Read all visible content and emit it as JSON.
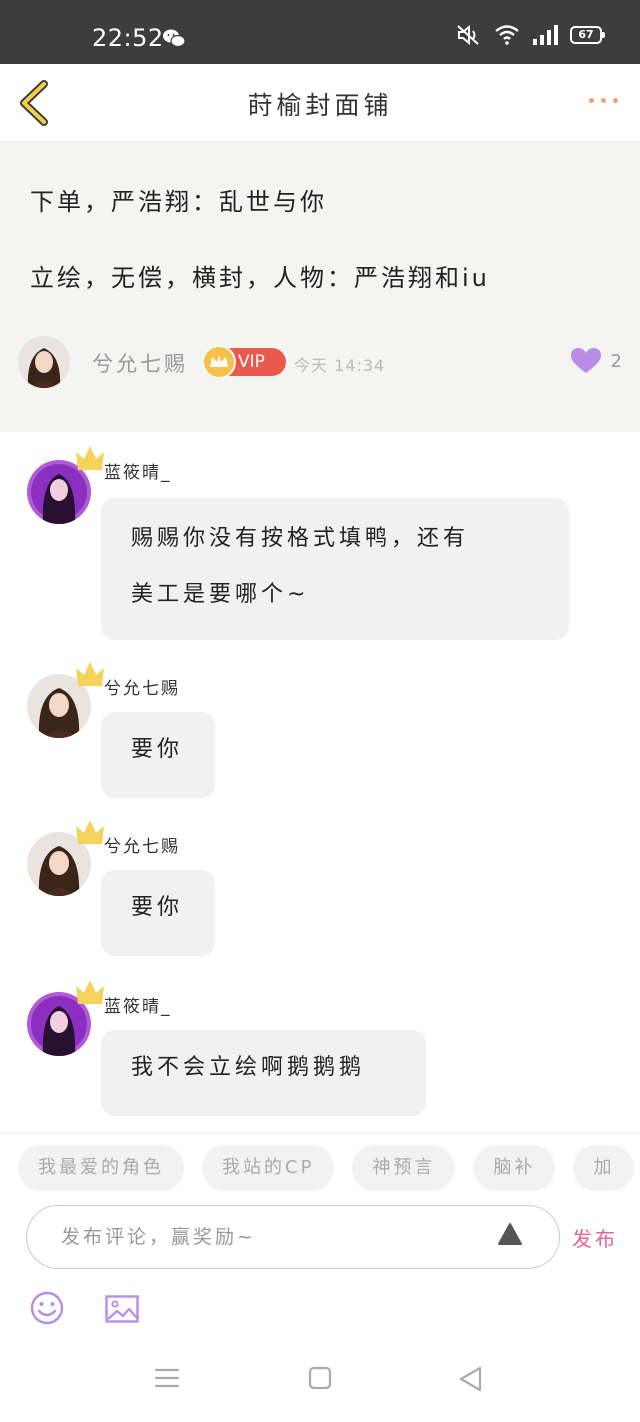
{
  "status_bar": {
    "time": "22:52",
    "battery": "67"
  },
  "header": {
    "title": "莳榆封面铺"
  },
  "post": {
    "line1": "下单，严浩翔：乱世与你",
    "line2": "立绘，无偿，横封，人物：严浩翔和iu",
    "author": "兮允七赐",
    "vip_label": "VIP",
    "time": "今天 14:34",
    "likes": "2"
  },
  "comments": [
    {
      "name": "蓝筱晴_",
      "lines": [
        "赐赐你没有按格式填鸭，还有",
        "美工是要哪个~"
      ]
    },
    {
      "name": "兮允七赐",
      "lines": [
        "要你"
      ]
    },
    {
      "name": "兮允七赐",
      "lines": [
        "要你"
      ]
    },
    {
      "name": "蓝筱晴_",
      "lines": [
        "我不会立绘啊鹅鹅鹅"
      ]
    }
  ],
  "tags": [
    "我最爱的角色",
    "我站的CP",
    "神预言",
    "脑补",
    "加"
  ],
  "comment_box": {
    "placeholder": "发布评论，赢奖励~",
    "publish_label": "发布"
  },
  "colors": {
    "accent_pink": "#e8609a",
    "like_purple": "#b98ce8",
    "vip_red": "#e95a4e",
    "back_yellow": "#f2cf4a"
  }
}
